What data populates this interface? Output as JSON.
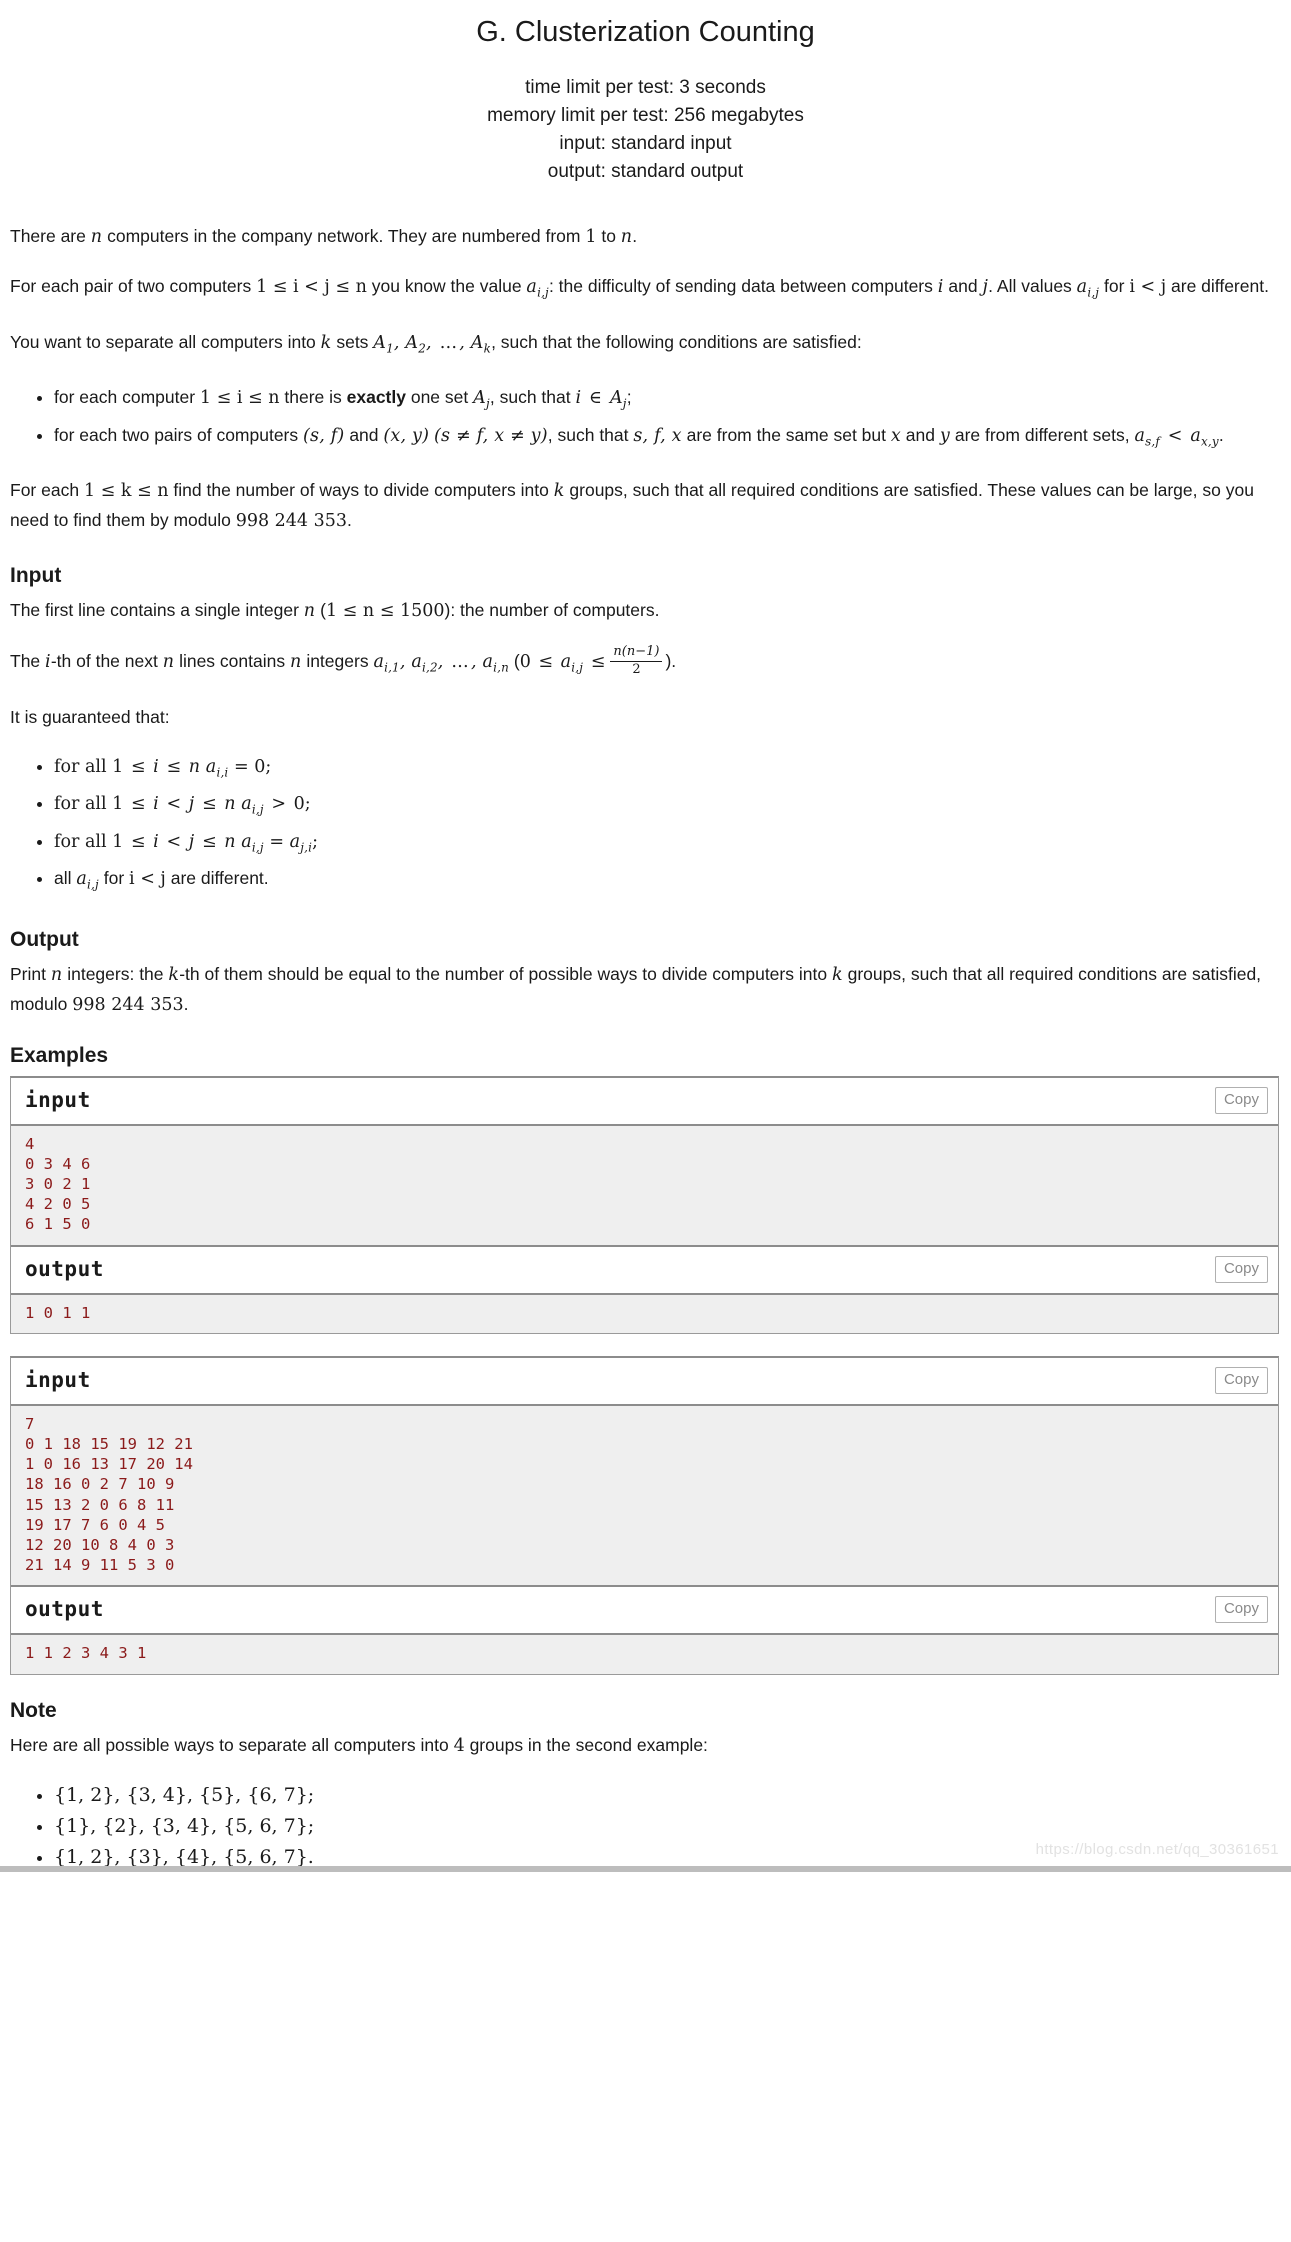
{
  "header": {
    "title": "G. Clusterization Counting",
    "time_limit": "time limit per test: 3 seconds",
    "memory_limit": "memory limit per test: 256 megabytes",
    "input_spec": "input: standard input",
    "output_spec": "output: standard output"
  },
  "statement": {
    "p1_a": "There are ",
    "p1_n": "n",
    "p1_b": " computers in the company network. They are numbered from ",
    "p1_one": "1",
    "p1_c": " to ",
    "p1_n2": "n",
    "p1_d": ".",
    "p2_a": "For each pair of two computers ",
    "p2_range": "1 ≤ i < j ≤ n",
    "p2_b": " you know the value ",
    "p2_a_ij": "ai,j",
    "p2_c": ": the difficulty of sending data between computers ",
    "p2_i": "i",
    "p2_d": " and ",
    "p2_j": "j",
    "p2_e": ". All values ",
    "p2_a_ij2": "ai,j",
    "p2_f": " for ",
    "p2_ij": "i < j",
    "p2_g": " are different.",
    "p3_a": "You want to separate all computers into ",
    "p3_k": "k",
    "p3_b": " sets ",
    "p3_sets": "A1, A2, …, Ak",
    "p3_c": ", such that the following conditions are satisfied:",
    "b1_a": "for each computer ",
    "b1_range": "1 ≤ i ≤ n",
    "b1_b": " there is ",
    "b1_bold": "exactly",
    "b1_c": " one set ",
    "b1_Aj": "Aj",
    "b1_d": ", such that ",
    "b1_in": "i ∈ Aj",
    "b1_e": ";",
    "b2_a": "for each two pairs of computers ",
    "b2_sf": "(s, f)",
    "b2_b": " and ",
    "b2_xy": "(x, y)",
    "b2_cond": "(s ≠ f, x ≠ y)",
    "b2_c": ", such that ",
    "b2_sfx": "s, f, x",
    "b2_d": " are from the same set but ",
    "b2_x": "x",
    "b2_e": " and ",
    "b2_y": "y",
    "b2_f": " are from different sets, ",
    "b2_ineq": "as,f < ax,y",
    "b2_g": ".",
    "p4_a": "For each ",
    "p4_range": "1 ≤ k ≤ n",
    "p4_b": " find the number of ways to divide computers into ",
    "p4_k": "k",
    "p4_c": " groups, such that all required conditions are satisfied. These values can be large, so you need to find them by modulo ",
    "p4_mod": "998 244 353",
    "p4_d": "."
  },
  "input_section": {
    "heading": "Input",
    "p1_a": "The first line contains a single integer ",
    "p1_n": "n",
    "p1_b": " (",
    "p1_range": "1 ≤ n ≤ 1500",
    "p1_c": "): the number of computers.",
    "p2_a": "The ",
    "p2_i": "i",
    "p2_b": "-th of the next ",
    "p2_n": "n",
    "p2_c": " lines contains ",
    "p2_n2": "n",
    "p2_d": " integers ",
    "p2_list": "ai,1, ai,2, …, ai,n",
    "p2_e": " (",
    "p2_le1": "0 ≤ ai,j ≤",
    "p2_frac_num": "n(n−1)",
    "p2_frac_den": "2",
    "p2_f": ").",
    "guaranteed": "It is guaranteed that:",
    "g1": "for all 1 ≤ i ≤ n ai,i = 0;",
    "g2": "for all 1 ≤ i < j ≤ n ai,j > 0;",
    "g3": "for all 1 ≤ i < j ≤ n ai,j = aj,i;",
    "g4_a": "all ",
    "g4_aij": "ai,j",
    "g4_b": " for ",
    "g4_ij": "i < j",
    "g4_c": " are different."
  },
  "output_section": {
    "heading": "Output",
    "p1_a": "Print ",
    "p1_n": "n",
    "p1_b": " integers: the ",
    "p1_k": "k",
    "p1_c": "-th of them should be equal to the number of possible ways to divide computers into ",
    "p1_k2": "k",
    "p1_d": " groups, such that all required conditions are satisfied, modulo ",
    "p1_mod": "998 244 353",
    "p1_e": "."
  },
  "examples": {
    "heading": "Examples",
    "copy_label": "Copy",
    "input_label": "input",
    "output_label": "output",
    "tests": [
      {
        "input": "4\n0 3 4 6\n3 0 2 1\n4 2 0 5\n6 1 5 0",
        "output": "1 0 1 1"
      },
      {
        "input": "7\n0 1 18 15 19 12 21\n1 0 16 13 17 20 14\n18 16 0 2 7 10 9\n15 13 2 0 6 8 11\n19 17 7 6 0 4 5\n12 20 10 8 4 0 3\n21 14 9 11 5 3 0",
        "output": "1 1 2 3 4 3 1"
      }
    ]
  },
  "note_section": {
    "heading": "Note",
    "p1_a": "Here are all possible ways to separate all computers into ",
    "p1_num": "4",
    "p1_b": " groups in the second example:",
    "items": [
      "{1, 2}, {3, 4}, {5}, {6, 7};",
      "{1}, {2}, {3, 4}, {5, 6, 7};",
      "{1, 2}, {3}, {4}, {5, 6, 7}."
    ]
  },
  "watermark": "https://blog.csdn.net/qq_30361651"
}
